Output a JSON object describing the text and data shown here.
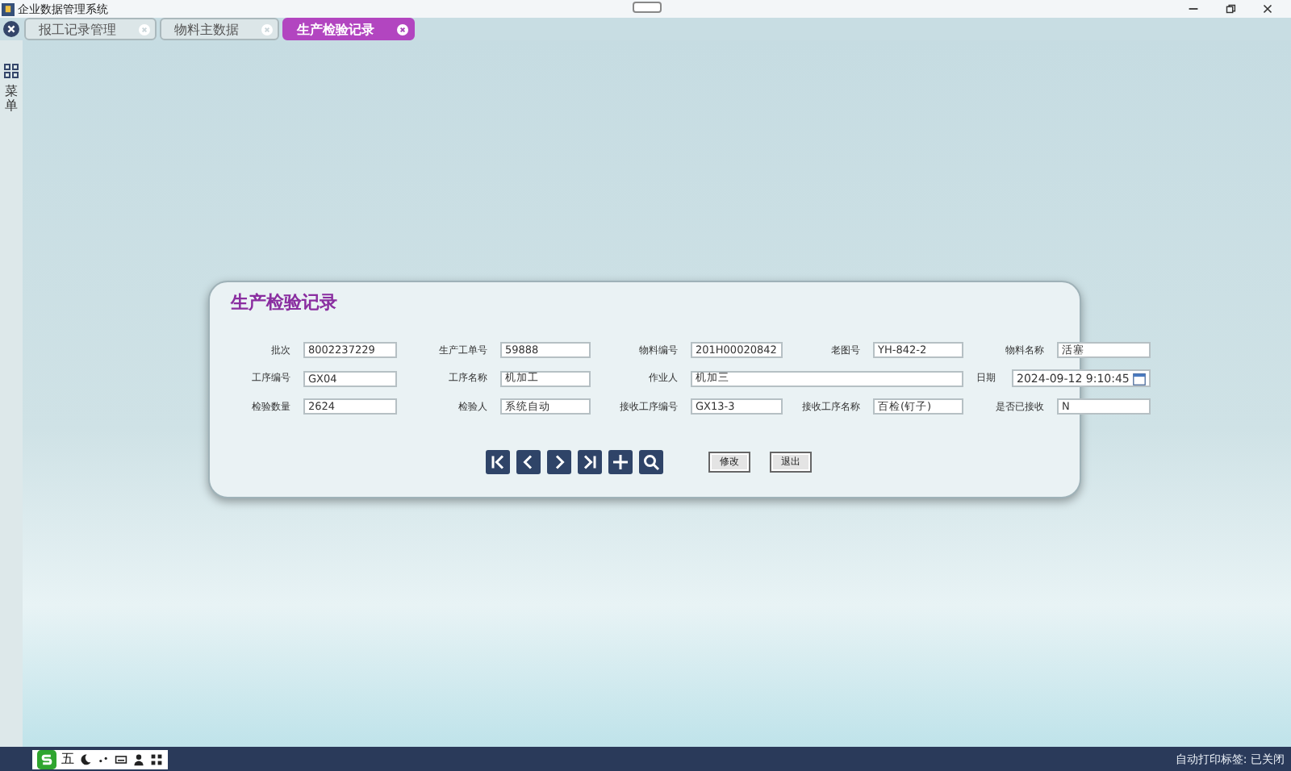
{
  "window": {
    "title": "企业数据管理系统"
  },
  "tabs": [
    {
      "label": "报工记录管理",
      "selected": false
    },
    {
      "label": "物料主数据",
      "selected": false
    },
    {
      "label": "生产检验记录",
      "selected": true
    }
  ],
  "sidebar": {
    "label": "菜单"
  },
  "form": {
    "title": "生产检验记录",
    "fields": [
      {
        "label": "批次",
        "value": "8002237229",
        "kind": "text"
      },
      {
        "label": "生产工单号",
        "value": "59888",
        "kind": "text"
      },
      {
        "label": "物料编号",
        "value": "201H00020842",
        "kind": "text"
      },
      {
        "label": "老图号",
        "value": "YH-842-2",
        "kind": "text"
      },
      {
        "label": "物料名称",
        "value": "活塞",
        "kind": "text"
      },
      {
        "label": "工序编号",
        "value": "GX04",
        "kind": "text"
      },
      {
        "label": "工序名称",
        "value": "机加工",
        "kind": "text"
      },
      {
        "label": "作业人",
        "value": "机加三",
        "kind": "wide"
      },
      {
        "label": "日期",
        "value": "2024-09-12 9:10:45",
        "kind": "date"
      },
      {
        "label": "检验数量",
        "value": "2624",
        "kind": "text"
      },
      {
        "label": "检验人",
        "value": "系统自动",
        "kind": "text"
      },
      {
        "label": "接收工序编号",
        "value": "GX13-3",
        "kind": "text"
      },
      {
        "label": "接收工序名称",
        "value": "百检(钉子)",
        "kind": "text"
      },
      {
        "label": "是否已接收",
        "value": "N",
        "kind": "text"
      }
    ],
    "nav_buttons": [
      {
        "kind": "first"
      },
      {
        "kind": "prev"
      },
      {
        "kind": "next"
      },
      {
        "kind": "last"
      },
      {
        "kind": "add"
      },
      {
        "kind": "search"
      }
    ],
    "actions": [
      "修改",
      "退出"
    ]
  },
  "taskbar": {
    "ime_mode": "五",
    "status": "自动打印标签: 已关闭"
  }
}
